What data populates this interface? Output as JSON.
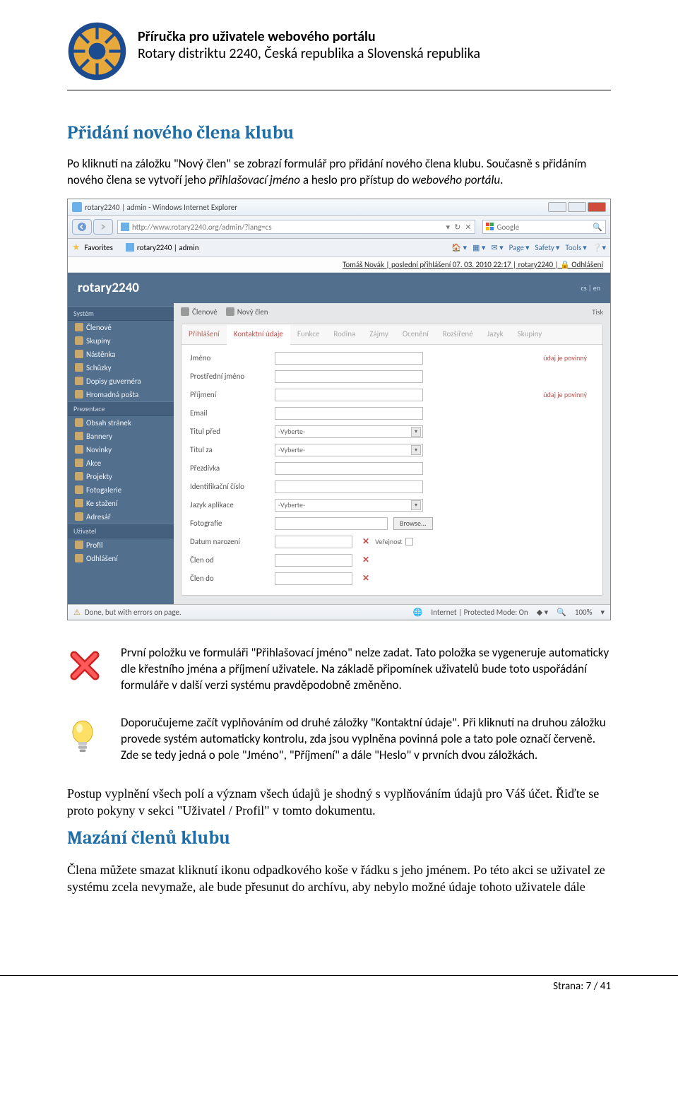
{
  "header": {
    "title": "Příručka pro uživatele webového portálu",
    "subtitle": "Rotary distriktu 2240, Česká republika a Slovenská republika"
  },
  "section1": {
    "title": "Přidání nového člena klubu",
    "p1a": "Po kliknutí na záložku \"Nový člen\" se zobrazí formulář pro přidání nového člena klubu. Současně s přidáním nového člena se vytvoří jeho ",
    "p1b": "přihlašovací jméno",
    "p1c": " a heslo pro přístup do ",
    "p1d": "webového portálu",
    "p1e": "."
  },
  "screenshot": {
    "window_title": "rotary2240 | admin - Windows Internet Explorer",
    "url": "http://www.rotary2240.org/admin/?lang=cs",
    "search_placeholder": "Google",
    "favorites_label": "Favorites",
    "tab_label": "rotary2240 | admin",
    "tools": {
      "page": "Page",
      "safety": "Safety",
      "tools": "Tools"
    },
    "status_top": "Tomáš Novák | poslední přihlášení 07. 03. 2010 22:17 | rotary2240 | 🔒 Odhlášení",
    "app_name": "rotary2240",
    "lang_flags": "cs | en",
    "sidebar": {
      "sec1": "Systém",
      "items1": [
        "Členové",
        "Skupiny",
        "Nástěnka",
        "Schůzky",
        "Dopisy guvernéra",
        "Hromadná pošta"
      ],
      "sec2": "Prezentace",
      "items2": [
        "Obsah stránek",
        "Bannery",
        "Novinky",
        "Akce",
        "Projekty",
        "Fotogalerie",
        "Ke stažení",
        "Adresář"
      ],
      "sec3": "Uživatel",
      "items3": [
        "Profil",
        "Odhlášení"
      ]
    },
    "breadcrumbs": {
      "b1": "Členové",
      "b2": "Nový člen"
    },
    "tisk": "Tisk",
    "tabs": [
      "Přihlášení",
      "Kontaktní údaje",
      "Funkce",
      "Rodina",
      "Zájmy",
      "Ocenění",
      "Rozšířené",
      "Jazyk",
      "Skupiny"
    ],
    "form": {
      "jmeno": "Jméno",
      "prostredni": "Prostřední jméno",
      "prijmeni": "Příjmení",
      "email": "Email",
      "titul_pred": "Titul před",
      "titul_za": "Titul za",
      "prezdivka": "Přezdívka",
      "ident": "Identifikační číslo",
      "jazyk": "Jazyk aplikace",
      "fotografie": "Fotografie",
      "datum_narozeni": "Datum narození",
      "clen_od": "Člen od",
      "clen_do": "Člen do",
      "vyberete": "-Vyberte-",
      "browse": "Browse...",
      "required": "údaj je povinný",
      "verejnost": "Veřejnost"
    },
    "statusbar": {
      "left": "Done, but with errors on page.",
      "mode": "Internet | Protected Mode: On",
      "zoom": "100%"
    }
  },
  "note1": "První položku ve formuláři \"Přihlašovací jméno\" nelze zadat. Tato položka se vygeneruje automaticky dle křestního jména a příjmení uživatele. Na základě připomínek uživatelů bude toto uspořádání formuláře v další verzi systému pravděpodobně změněno.",
  "note2": "Doporučujeme začít vyplňováním od druhé záložky \"Kontaktní údaje\". Při kliknutí na druhou záložku provede systém automaticky kontrolu, zda jsou vyplněna povinná pole a tato pole označí červeně. Zde se tedy jedná o pole \"Jméno\", \"Příjmení\" a dále \"Heslo\" v prvních dvou záložkách.",
  "body1": "Postup vyplnění všech polí a význam všech údajů je shodný s vyplňováním údajů pro Váš účet. Řiďte se proto pokyny v sekci \"Uživatel / Profil\" v tomto dokumentu.",
  "section2_title": "Mazání členů klubu",
  "body2": "Člena můžete smazat kliknutí ikonu odpadkového koše v řádku s jeho jménem. Po této akci se uživatel ze systému zcela nevymaže, ale bude přesunut do archívu, aby nebylo možné údaje tohoto uživatele dále",
  "footer": "Strana: 7 / 41"
}
